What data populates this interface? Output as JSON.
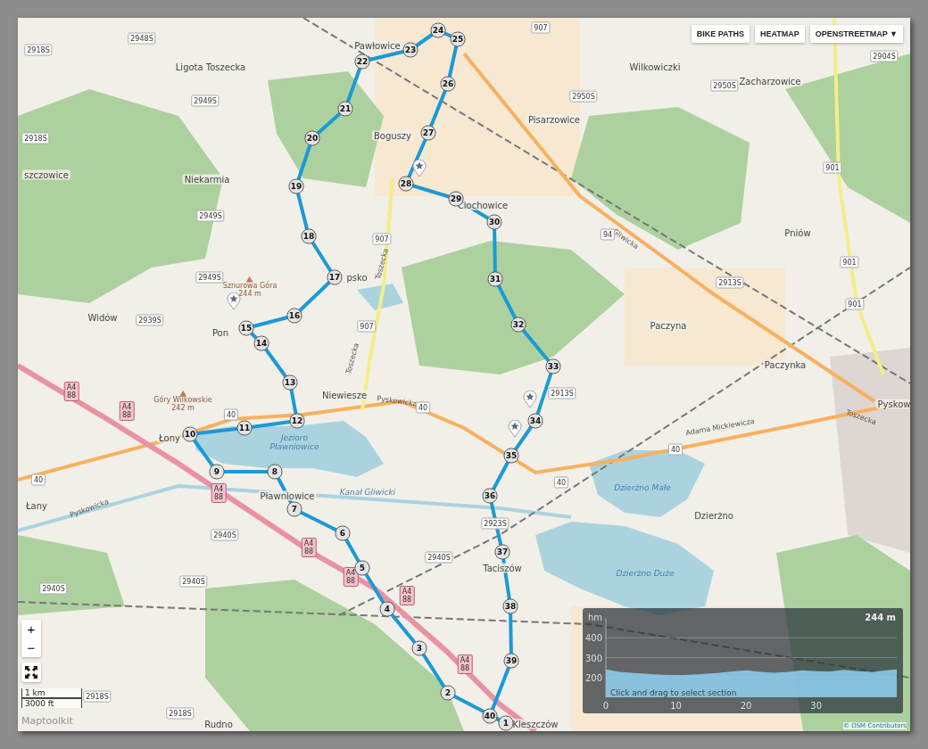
{
  "layer_buttons": [
    {
      "label": "BIKE PATHS"
    },
    {
      "label": "HEATMAP"
    },
    {
      "label": "OPENSTREETMAP ▼"
    }
  ],
  "map": {
    "places": [
      "Pawłowice",
      "Ligota Toszecka",
      "Wilkowiczki",
      "Zacharzowice",
      "Pisarzowice",
      "Boguszy",
      "Niekarmia",
      "szczowice",
      "Ciochowice",
      "Pniów",
      "Paczyna",
      "Paczynka",
      "Pyskow",
      "Widów",
      "Pon",
      "Niewiesze",
      "Łany",
      "Dzierżno",
      "Taciszów",
      "Rudno",
      "Pławniowice",
      "psko",
      "Kleszczów",
      "Łony"
    ],
    "peaks": [
      {
        "name": "Sznurowa Góra",
        "elevation": "244 m"
      },
      {
        "name": "Góry Wilkowskie",
        "elevation": "242 m"
      }
    ],
    "water_labels": [
      "Jezioro Pławniowice",
      "Dzierżno Małe",
      "Dzierżno Duże",
      "Kanał Gliwicki"
    ],
    "street_labels": [
      "Toszecka",
      "Toszecka",
      "Pyskowicka",
      "Pyskowicka",
      "Gliwicka",
      "Adama Mickiewicza",
      "Toszecka"
    ],
    "road_shields": [
      {
        "kind": "local",
        "label": "2918S"
      },
      {
        "kind": "local",
        "label": "2948S"
      },
      {
        "kind": "local",
        "label": "907"
      },
      {
        "kind": "local",
        "label": "2950S"
      },
      {
        "kind": "local",
        "label": "2950S"
      },
      {
        "kind": "local",
        "label": "2904S"
      },
      {
        "kind": "local",
        "label": "2918S"
      },
      {
        "kind": "local",
        "label": "2949S"
      },
      {
        "kind": "local",
        "label": "2949S"
      },
      {
        "kind": "local",
        "label": "2949S"
      },
      {
        "kind": "local",
        "label": "907"
      },
      {
        "kind": "local",
        "label": "907"
      },
      {
        "kind": "local",
        "label": "901"
      },
      {
        "kind": "local",
        "label": "901"
      },
      {
        "kind": "local",
        "label": "901"
      },
      {
        "kind": "local",
        "label": "2939S"
      },
      {
        "kind": "local",
        "label": "2913S"
      },
      {
        "kind": "local",
        "label": "2913S"
      },
      {
        "kind": "local",
        "label": "40"
      },
      {
        "kind": "local",
        "label": "40"
      },
      {
        "kind": "local",
        "label": "40"
      },
      {
        "kind": "local",
        "label": "40"
      },
      {
        "kind": "local",
        "label": "40"
      },
      {
        "kind": "local",
        "label": "94"
      },
      {
        "kind": "motorway",
        "label": "A4",
        "sub": "88"
      },
      {
        "kind": "motorway",
        "label": "A4",
        "sub": "88"
      },
      {
        "kind": "motorway",
        "label": "A4",
        "sub": "88"
      },
      {
        "kind": "motorway",
        "label": "A4",
        "sub": "88"
      },
      {
        "kind": "motorway",
        "label": "A4",
        "sub": "88"
      },
      {
        "kind": "motorway",
        "label": "A4",
        "sub": "88"
      },
      {
        "kind": "motorway",
        "label": "A4",
        "sub": "88"
      },
      {
        "kind": "local",
        "label": "2940S"
      },
      {
        "kind": "local",
        "label": "2940S"
      },
      {
        "kind": "local",
        "label": "2940S"
      },
      {
        "kind": "local",
        "label": "2940S"
      },
      {
        "kind": "local",
        "label": "2923S"
      },
      {
        "kind": "local",
        "label": "2918S"
      },
      {
        "kind": "local",
        "label": "2918S"
      }
    ],
    "waypoints": [
      "1",
      "2",
      "3",
      "4",
      "5",
      "6",
      "7",
      "8",
      "9",
      "10",
      "11",
      "12",
      "13",
      "14",
      "15",
      "16",
      "17",
      "18",
      "19",
      "20",
      "21",
      "22",
      "23",
      "24",
      "25",
      "26",
      "27",
      "28",
      "29",
      "30",
      "31",
      "32",
      "33",
      "34",
      "35",
      "36",
      "37",
      "38",
      "39",
      "40"
    ],
    "zoom_in": "+",
    "zoom_out": "−",
    "scale": {
      "metric": "1 km",
      "imperial": "3000 ft"
    },
    "logo": "Maptoolkit",
    "attribution": "© OSM Contributors"
  },
  "elevation_profile": {
    "unit": "hm",
    "current": "244 m",
    "hint": "Click and drag to select section",
    "chart_data": {
      "type": "area",
      "x": [
        0,
        2,
        4,
        6,
        8,
        10,
        12,
        14,
        16,
        18,
        20,
        22,
        24,
        26,
        28,
        30,
        32,
        34,
        36,
        38,
        40,
        41.5
      ],
      "series": [
        {
          "color": "#8fd0f2",
          "values": [
            240,
            228,
            222,
            218,
            214,
            212,
            214,
            218,
            222,
            230,
            236,
            228,
            224,
            228,
            236,
            232,
            230,
            238,
            232,
            228,
            236,
            240
          ]
        }
      ],
      "xlim": [
        0,
        41.5
      ],
      "ylim": [
        100,
        500
      ],
      "xticks": [
        0,
        10,
        20,
        30
      ],
      "yticks": [
        200,
        300,
        400
      ]
    }
  }
}
